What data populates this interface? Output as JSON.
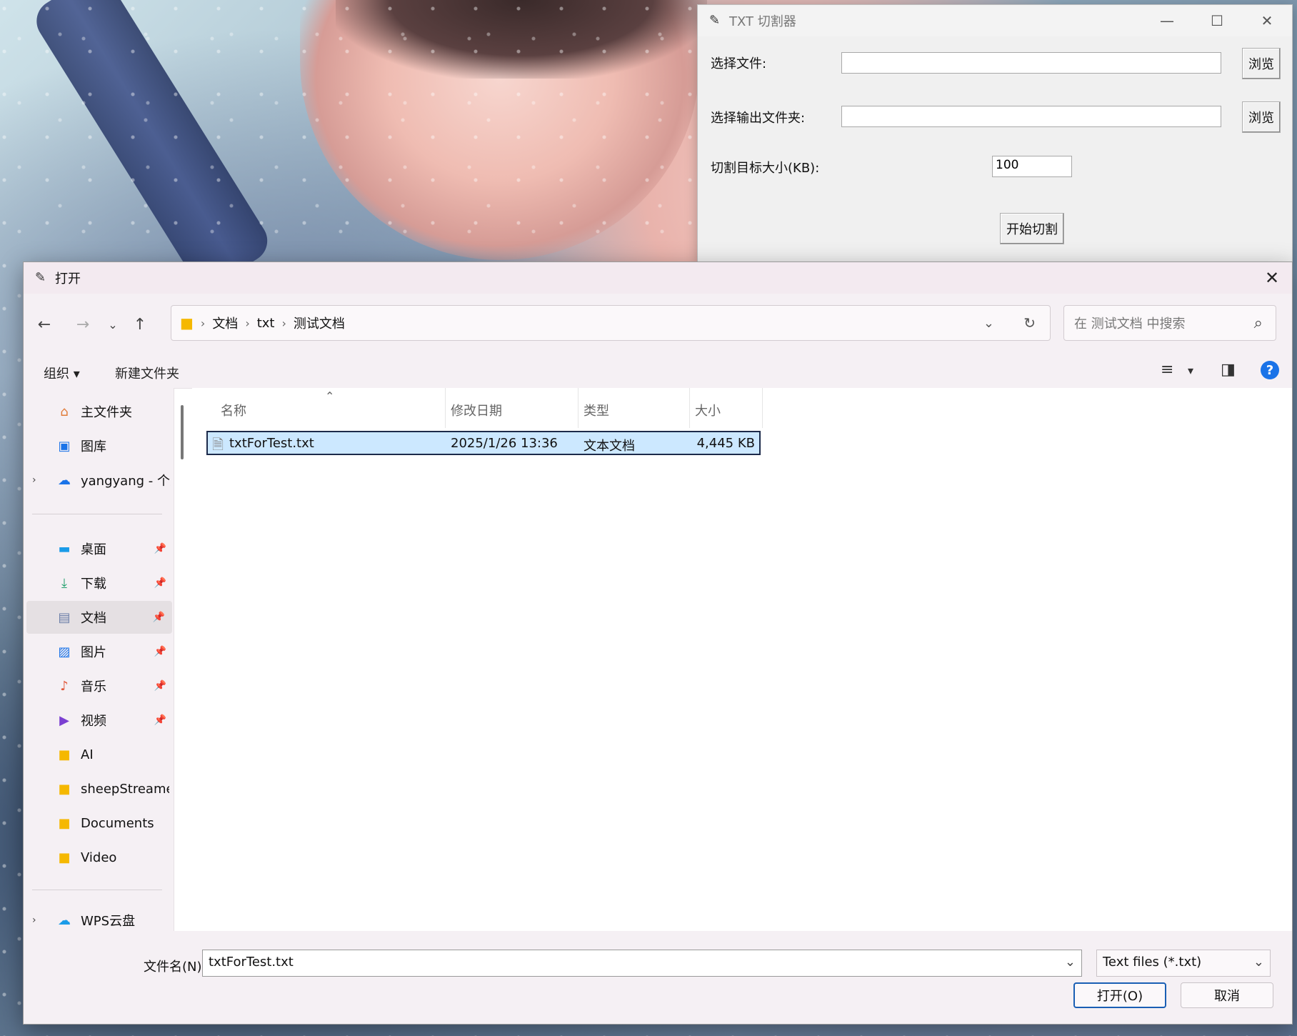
{
  "app": {
    "title": "TXT 切割器",
    "select_file_label": "选择文件:",
    "select_file_value": "",
    "browse_file_label": "浏览",
    "select_output_label": "选择输出文件夹:",
    "select_output_value": "",
    "browse_output_label": "浏览",
    "target_size_label": "切割目标大小(KB):",
    "target_size_value": "100",
    "start_button_label": "开始切割"
  },
  "dialog": {
    "title": "打开",
    "breadcrumb": [
      "文档",
      "txt",
      "测试文档"
    ],
    "search_placeholder": "在 测试文档 中搜索",
    "toolbar": {
      "organize": "组织",
      "new_folder": "新建文件夹"
    },
    "sidebar": {
      "items": [
        {
          "label": "主文件夹",
          "icon": "home-icon"
        },
        {
          "label": "图库",
          "icon": "gallery-icon"
        },
        {
          "label": "yangyang - 个人",
          "icon": "onedrive-icon"
        },
        {
          "label": "桌面",
          "icon": "desktop-icon"
        },
        {
          "label": "下载",
          "icon": "download-icon"
        },
        {
          "label": "文档",
          "icon": "document-icon"
        },
        {
          "label": "图片",
          "icon": "pictures-icon"
        },
        {
          "label": "音乐",
          "icon": "music-icon"
        },
        {
          "label": "视频",
          "icon": "video-icon"
        },
        {
          "label": "AI",
          "icon": "folder-icon"
        },
        {
          "label": "sheepStreamer",
          "icon": "folder-icon"
        },
        {
          "label": "Documents",
          "icon": "folder-icon"
        },
        {
          "label": "Video",
          "icon": "folder-icon"
        },
        {
          "label": "WPS云盘",
          "icon": "wps-cloud-icon"
        }
      ]
    },
    "columns": [
      "名称",
      "修改日期",
      "类型",
      "大小"
    ],
    "files": [
      {
        "name": "txtForTest.txt",
        "modified": "2025/1/26 13:36",
        "type": "文本文档",
        "size": "4,445 KB"
      }
    ],
    "filename_label": "文件名(N):",
    "filename_value": "txtForTest.txt",
    "filter_value": "Text files (*.txt)",
    "open_label": "打开(O)",
    "cancel_label": "取消"
  },
  "colors": {
    "accent": "#1a73e8",
    "selection": "#cce8ff"
  }
}
